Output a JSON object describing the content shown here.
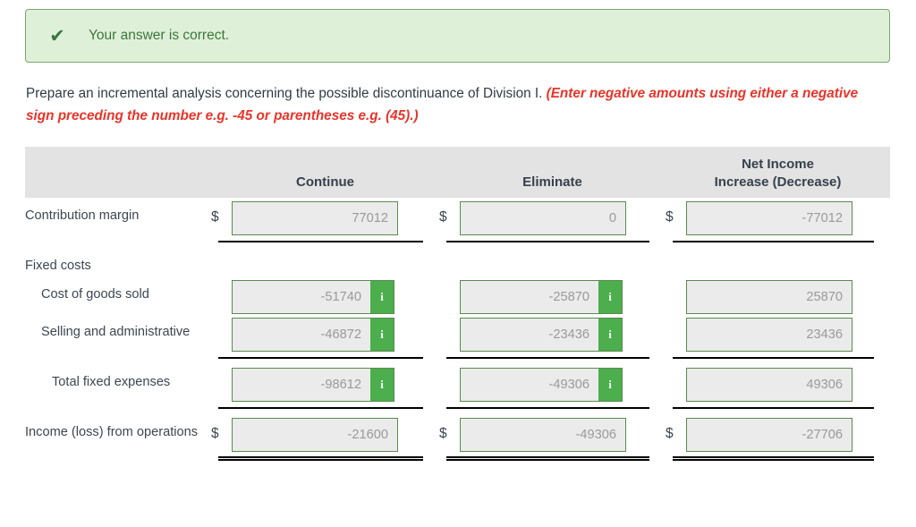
{
  "alert": {
    "icon": "check-icon",
    "message": "Your answer is correct."
  },
  "instruction": {
    "main": "Prepare an incremental analysis concerning the possible discontinuance of Division I.",
    "emphasis": "(Enter negative amounts using either a negative sign preceding the number e.g. -45 or parentheses e.g. (45).)"
  },
  "table": {
    "headers": {
      "label": "",
      "col1": "Continue",
      "col2": "Eliminate",
      "col3_line1": "Net Income",
      "col3_line2": "Increase (Decrease)"
    },
    "rows": [
      {
        "label": "Contribution margin",
        "indent": 0,
        "dollar": true,
        "info": false,
        "values": [
          "77012",
          "0",
          "-77012"
        ],
        "rule": "single"
      },
      {
        "label": "Fixed costs",
        "indent": 0,
        "dollar": false,
        "info": false,
        "values": [
          "",
          "",
          ""
        ],
        "rule": "none"
      },
      {
        "label": "Cost of goods sold",
        "indent": 1,
        "dollar": false,
        "info": true,
        "values": [
          "-51740",
          "-25870",
          "25870"
        ],
        "rule": "none"
      },
      {
        "label": "Selling and administrative",
        "indent": 1,
        "dollar": false,
        "info": true,
        "values": [
          "-46872",
          "-23436",
          "23436"
        ],
        "rule": "single"
      },
      {
        "label": "Total fixed expenses",
        "indent": 2,
        "dollar": false,
        "info": true,
        "values": [
          "-98612",
          "-49306",
          "49306"
        ],
        "rule": "single"
      },
      {
        "label": "Income (loss) from operations",
        "indent": 0,
        "dollar": true,
        "info": false,
        "values": [
          "-21600",
          "-49306",
          "-27706"
        ],
        "rule": "double"
      }
    ],
    "info_button_label": "i"
  },
  "colors": {
    "alert_bg": "#dff0d8",
    "alert_border": "#7aa66f",
    "alert_text": "#3c763d",
    "emphasis_text": "#e8342a",
    "header_bg": "#e3e3e3",
    "field_border": "#5b8a4f",
    "field_bg": "#ebebeb",
    "info_bg": "#4cae4c",
    "value_text": "#9a9a9a"
  }
}
